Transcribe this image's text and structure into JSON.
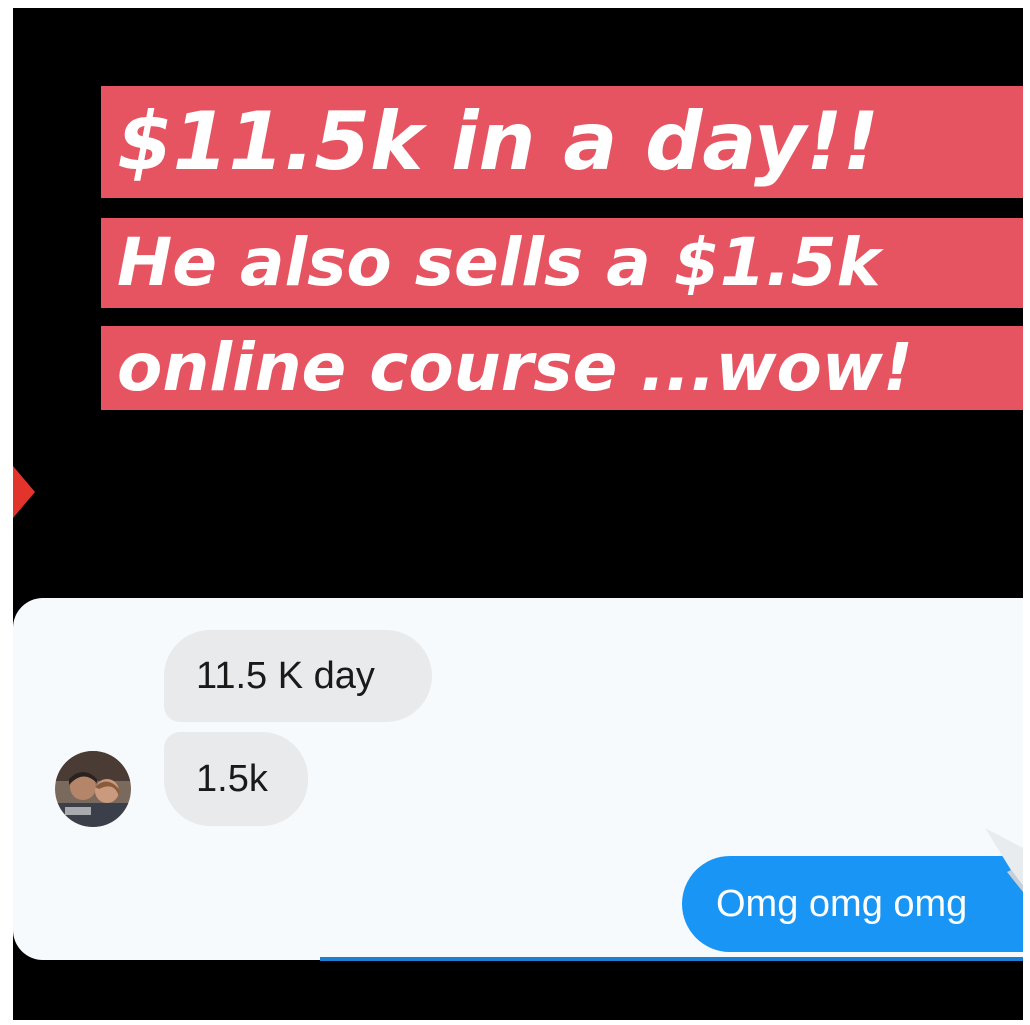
{
  "banner": {
    "line1": "$11.5k in a day!!",
    "line2": "He also sells a $1.5k",
    "line3": "online course ...wow!"
  },
  "chat": {
    "incoming": [
      {
        "text": "11.5 K day"
      },
      {
        "text": "1.5k"
      }
    ],
    "outgoing": [
      {
        "text": "Omg omg omg"
      }
    ]
  },
  "icons": {
    "annotation_arrow": "arrow-right-icon",
    "avatar": "avatar",
    "send": "send-icon"
  },
  "colors": {
    "background": "#000000",
    "banner": "#e65361",
    "incoming_bubble": "#e9eaec",
    "outgoing_bubble": "#1996f5",
    "chat_panel": "#f7fafc",
    "arrow": "#e2342a"
  }
}
